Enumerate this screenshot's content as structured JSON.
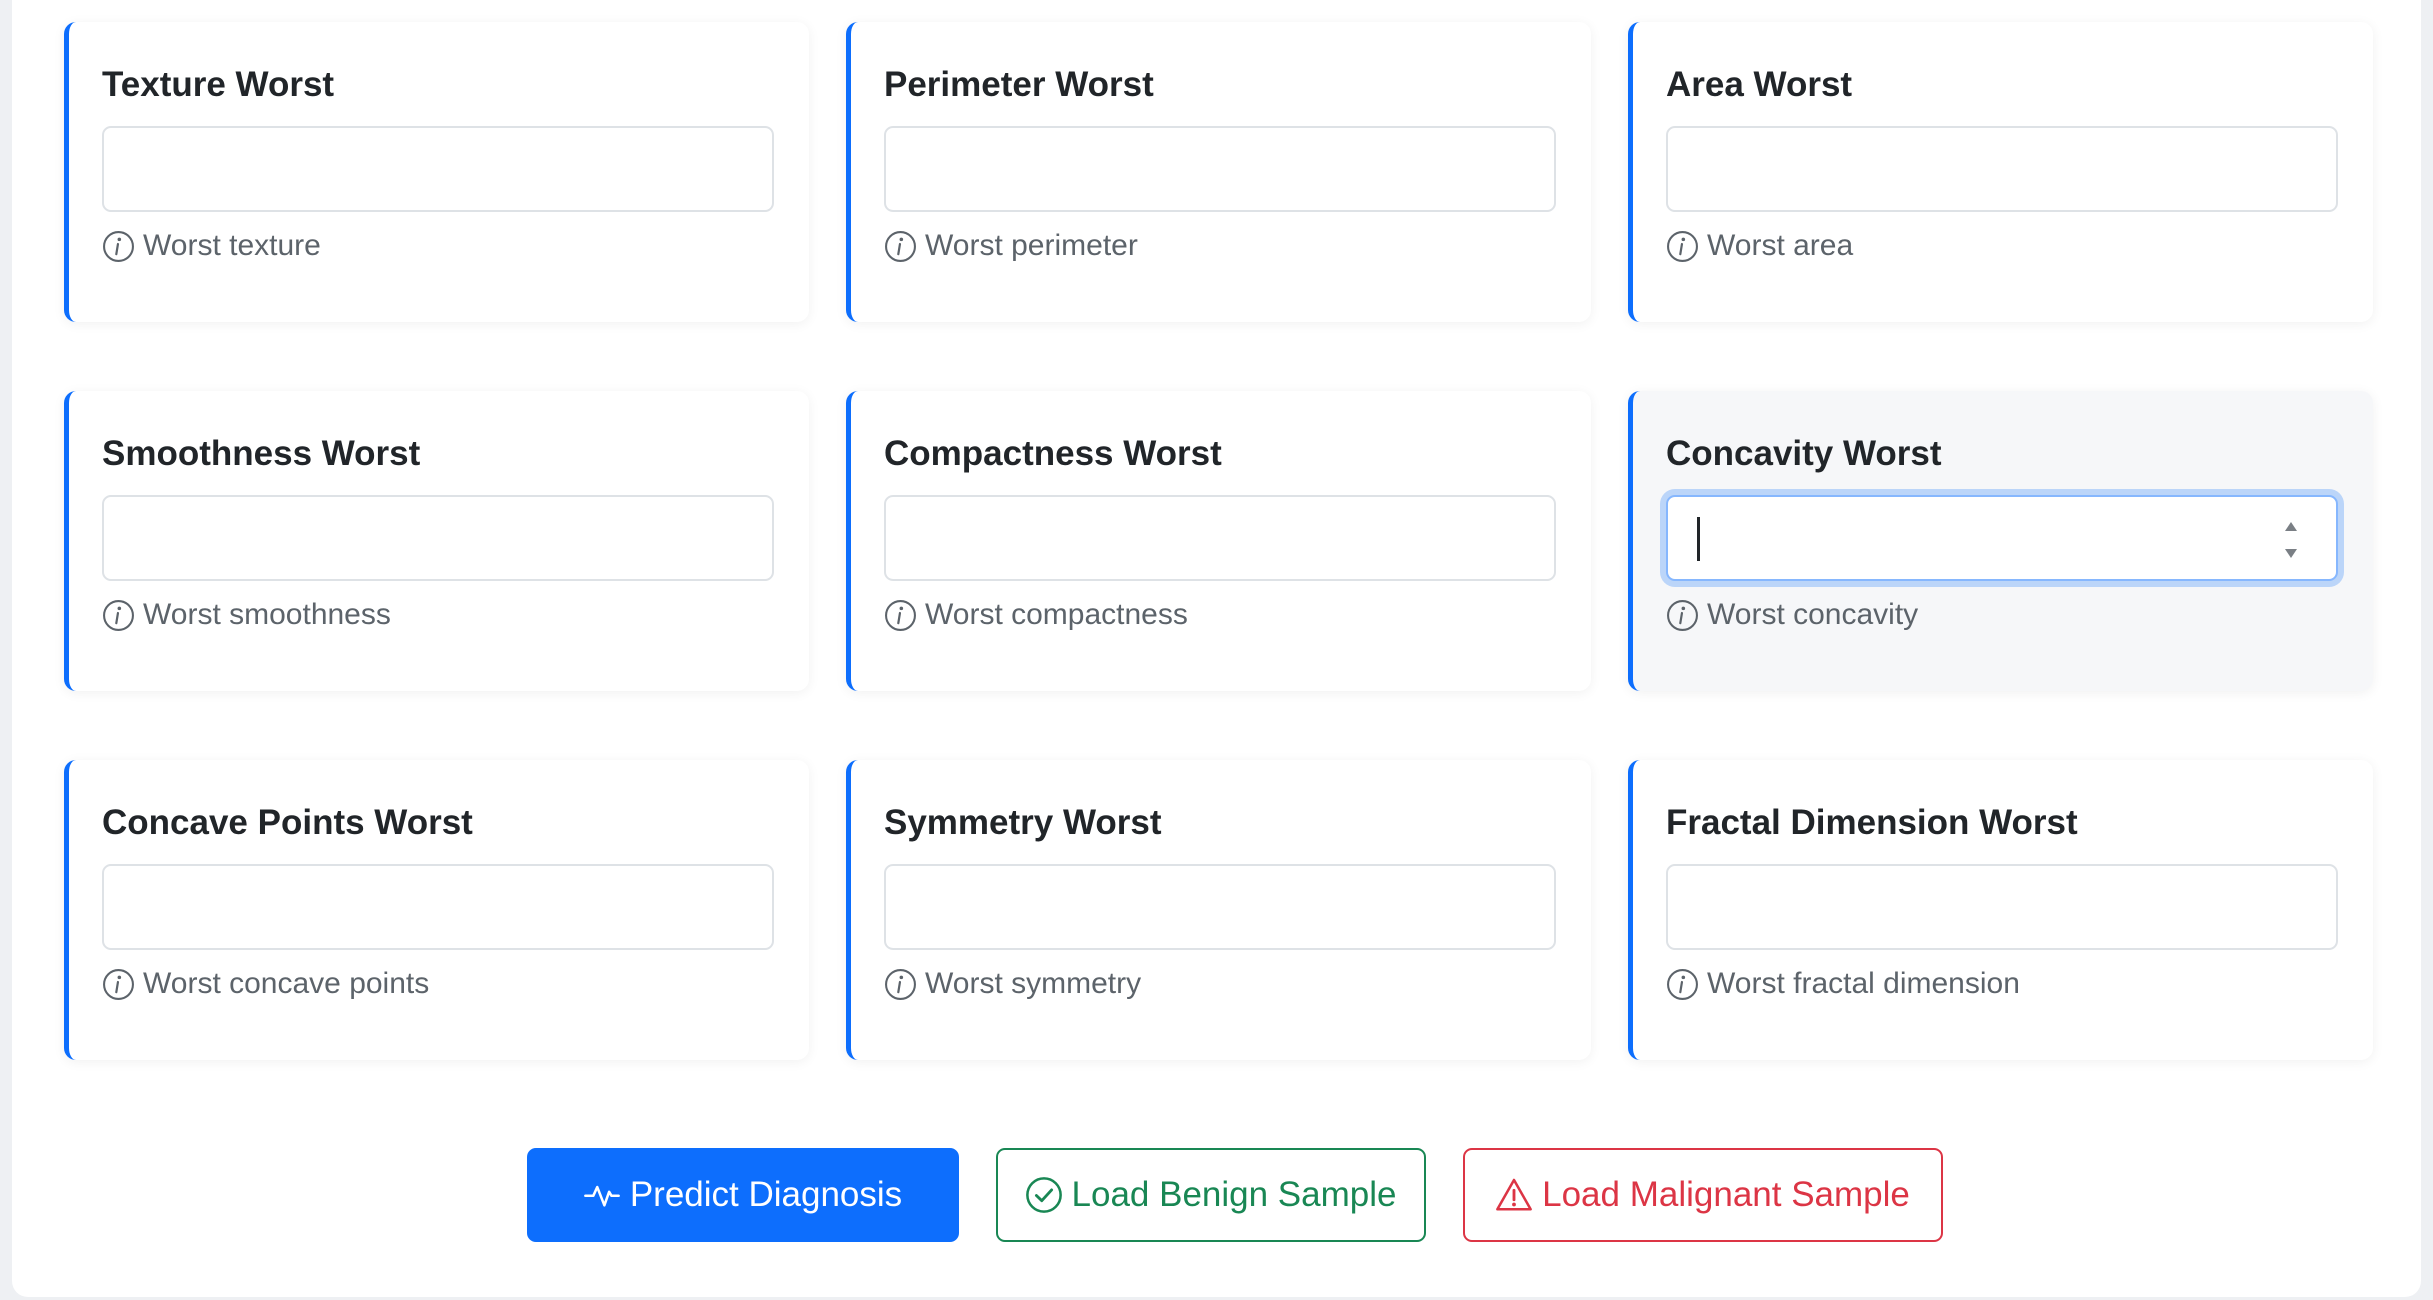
{
  "fields": [
    {
      "title": "Texture Worst",
      "hint": "Worst texture",
      "value": ""
    },
    {
      "title": "Perimeter Worst",
      "hint": "Worst perimeter",
      "value": ""
    },
    {
      "title": "Area Worst",
      "hint": "Worst area",
      "value": ""
    },
    {
      "title": "Smoothness Worst",
      "hint": "Worst smoothness",
      "value": ""
    },
    {
      "title": "Compactness Worst",
      "hint": "Worst compactness",
      "value": ""
    },
    {
      "title": "Concavity Worst",
      "hint": "Worst concavity",
      "value": "",
      "focused": true
    },
    {
      "title": "Concave Points Worst",
      "hint": "Worst concave points",
      "value": ""
    },
    {
      "title": "Symmetry Worst",
      "hint": "Worst symmetry",
      "value": ""
    },
    {
      "title": "Fractal Dimension Worst",
      "hint": "Worst fractal dimension",
      "value": ""
    }
  ],
  "actions": {
    "predict": {
      "label": "Predict Diagnosis",
      "icon": "activity-icon"
    },
    "benign": {
      "label": "Load Benign Sample",
      "icon": "check-circle-icon"
    },
    "malignant": {
      "label": "Load Malignant Sample",
      "icon": "warning-triangle-icon"
    }
  },
  "colors": {
    "primary": "#0d6efd",
    "success": "#198754",
    "danger": "#dc3545",
    "card_accent": "#0d6efd"
  }
}
